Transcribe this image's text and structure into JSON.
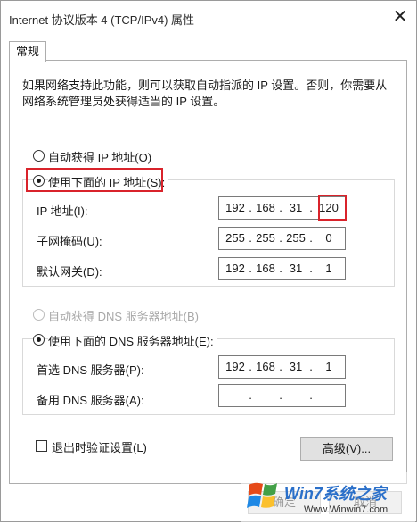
{
  "window": {
    "title": "Internet 协议版本 4 (TCP/IPv4) 属性",
    "close_glyph": "✕"
  },
  "tab": {
    "label": "常规"
  },
  "description": "如果网络支持此功能，则可以获取自动指派的 IP 设置。否则，你需要从网络系统管理员处获得适当的 IP 设置。",
  "ip_section": {
    "auto_label": "自动获得 IP 地址(O)",
    "manual_label": "使用下面的 IP 地址(S):",
    "selected": "manual",
    "fields": [
      {
        "label": "IP 地址(I):",
        "octets": [
          "192",
          "168",
          "31",
          "120"
        ]
      },
      {
        "label": "子网掩码(U):",
        "octets": [
          "255",
          "255",
          "255",
          "0"
        ]
      },
      {
        "label": "默认网关(D):",
        "octets": [
          "192",
          "168",
          "31",
          "1"
        ]
      }
    ]
  },
  "dns_section": {
    "auto_label": "自动获得 DNS 服务器地址(B)",
    "manual_label": "使用下面的 DNS 服务器地址(E):",
    "selected": "manual",
    "fields": [
      {
        "label": "首选 DNS 服务器(P):",
        "octets": [
          "192",
          "168",
          "31",
          "1"
        ]
      },
      {
        "label": "备用 DNS 服务器(A):",
        "octets": [
          "",
          "",
          "",
          ""
        ]
      }
    ]
  },
  "validate_checkbox": {
    "label": "退出时验证设置(L)",
    "checked": false
  },
  "buttons": {
    "advanced": "高级(V)...",
    "ok": "确定",
    "cancel": "取消"
  },
  "watermark": {
    "brand_text": "Win7系统之家",
    "url_text": "Www.Winwin7.com"
  },
  "colors": {
    "highlight_red": "#d9232b",
    "disabled_text": "#a8a8a8"
  }
}
